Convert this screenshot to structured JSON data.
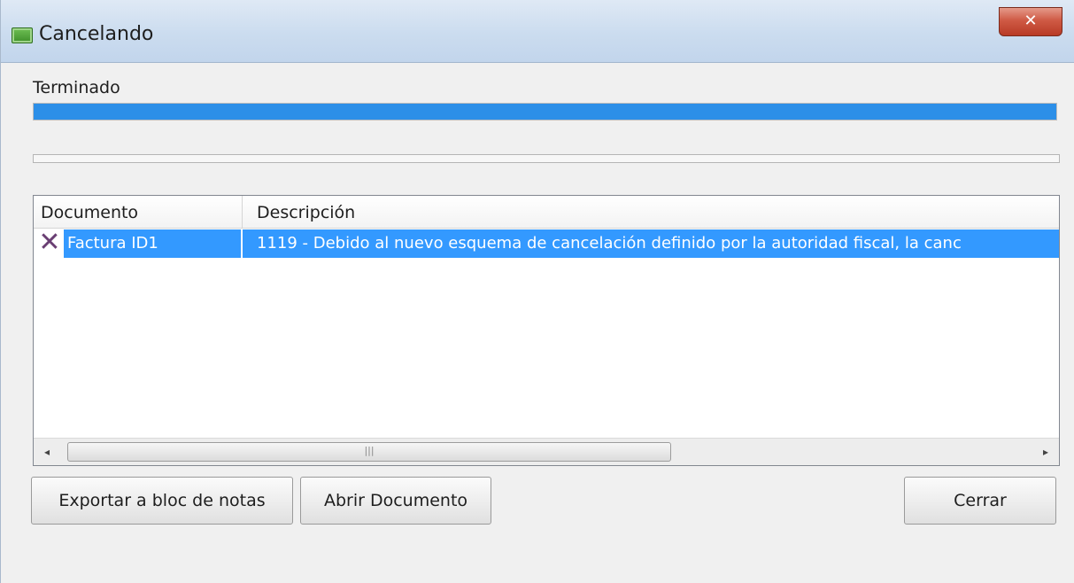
{
  "window": {
    "title": "Cancelando",
    "close_glyph": "✕",
    "icon": "app-window-icon"
  },
  "progress": {
    "status_label": "Terminado",
    "overall_fraction": 1.0,
    "secondary_fraction": 0.0,
    "color": "#2c8fe8"
  },
  "list": {
    "columns": [
      "Documento",
      "Descripción"
    ],
    "rows": [
      {
        "status_icon": "error-x-icon",
        "documento": "Factura ID1",
        "descripcion": "1119 - Debido al nuevo esquema de cancelación definido por la autoridad fiscal, la canc"
      }
    ],
    "selection_color": "#3399ff",
    "scroll": {
      "left_glyph": "◂",
      "right_glyph": "▸",
      "thumb_grip": "|||"
    }
  },
  "buttons": {
    "export": "Exportar a bloc de notas",
    "open": "Abrir Documento",
    "close": "Cerrar"
  }
}
